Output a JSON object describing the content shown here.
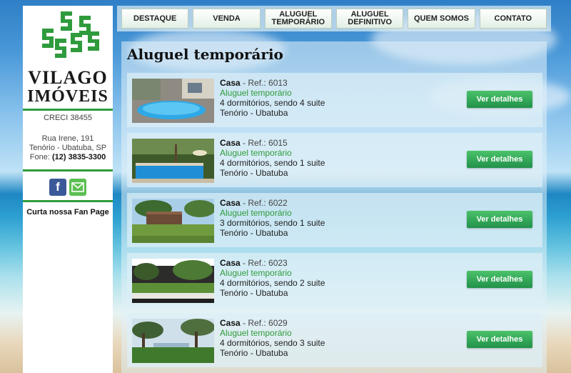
{
  "sidebar": {
    "brand_line1": "VILAGO",
    "brand_line2": "IMÓVEIS",
    "creci": "CRECI 38455",
    "address_line1": "Rua Irene, 191",
    "address_line2": "Tenório - Ubatuba, SP",
    "phone_label": "Fone:",
    "phone": "(12) 3835-3300",
    "facebook_glyph": "f",
    "fan_page": "Curta nossa Fan Page"
  },
  "nav": {
    "items": [
      "DESTAQUE",
      "VENDA",
      "ALUGUEL\nTEMPORÁRIO",
      "ALUGUEL\nDEFINITIVO",
      "QUEM SOMOS",
      "CONTATO"
    ]
  },
  "main": {
    "title": "Aluguel temporário",
    "listings": [
      {
        "type": "Casa",
        "ref": " - Ref.: 6013",
        "mode": "Aluguel temporário",
        "rooms": "4 dormitórios, sendo 4 suite",
        "location": "Tenório - Ubatuba",
        "button": "Ver detalhes"
      },
      {
        "type": "Casa",
        "ref": " - Ref.: 6015",
        "mode": "Aluguel temporário",
        "rooms": "4 dormitórios, sendo 1 suite",
        "location": "Tenório - Ubatuba",
        "button": "Ver detalhes"
      },
      {
        "type": "Casa",
        "ref": " - Ref.: 6022",
        "mode": "Aluguel temporário",
        "rooms": "3 dormitórios, sendo 1 suite",
        "location": "Tenório - Ubatuba",
        "button": "Ver detalhes"
      },
      {
        "type": "Casa",
        "ref": " - Ref.: 6023",
        "mode": "Aluguel temporário",
        "rooms": "4 dormitórios, sendo 2 suite",
        "location": "Tenório - Ubatuba",
        "button": "Ver detalhes"
      },
      {
        "type": "Casa",
        "ref": " - Ref.: 6029",
        "mode": "Aluguel temporário",
        "rooms": "4 dormitórios, sendo 3 suite",
        "location": "Tenório - Ubatuba",
        "button": "Ver detalhes"
      }
    ]
  },
  "colors": {
    "accent_green": "#2f9b3c",
    "button_green": "#21914a",
    "facebook_blue": "#3b5998"
  },
  "icons": [
    "facebook-icon",
    "email-icon",
    "logo-s-icon"
  ]
}
